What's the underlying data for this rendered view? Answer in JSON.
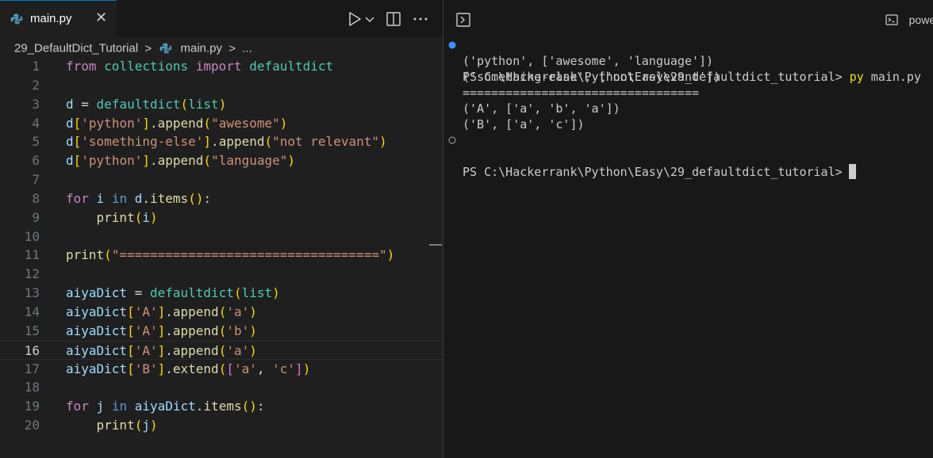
{
  "editor": {
    "tab": {
      "label": "main.py",
      "close": "✕"
    },
    "toolbar": {
      "more": "···"
    },
    "breadcrumb": {
      "folder": "29_DefaultDict_Tutorial",
      "file": "main.py",
      "ellipsis": "..."
    },
    "current_line": 16,
    "lines": [
      {
        "n": "1",
        "tokens": [
          {
            "t": "from",
            "c": "kw"
          },
          {
            "t": " "
          },
          {
            "t": "collections",
            "c": "cl"
          },
          {
            "t": " "
          },
          {
            "t": "import",
            "c": "kw"
          },
          {
            "t": " "
          },
          {
            "t": "defaultdict",
            "c": "cl"
          }
        ]
      },
      {
        "n": "2",
        "tokens": []
      },
      {
        "n": "3",
        "tokens": [
          {
            "t": "d",
            "c": "vr"
          },
          {
            "t": " = ",
            "c": "pl"
          },
          {
            "t": "defaultdict",
            "c": "cl"
          },
          {
            "t": "(",
            "c": "b1"
          },
          {
            "t": "list",
            "c": "cl"
          },
          {
            "t": ")",
            "c": "b1"
          }
        ]
      },
      {
        "n": "4",
        "tokens": [
          {
            "t": "d",
            "c": "vr"
          },
          {
            "t": "[",
            "c": "b1"
          },
          {
            "t": "'python'",
            "c": "st"
          },
          {
            "t": "]",
            "c": "b1"
          },
          {
            "t": ".",
            "c": "pl"
          },
          {
            "t": "append",
            "c": "fn"
          },
          {
            "t": "(",
            "c": "b1"
          },
          {
            "t": "\"awesome\"",
            "c": "st"
          },
          {
            "t": ")",
            "c": "b1"
          }
        ]
      },
      {
        "n": "5",
        "tokens": [
          {
            "t": "d",
            "c": "vr"
          },
          {
            "t": "[",
            "c": "b1"
          },
          {
            "t": "'something-else'",
            "c": "st"
          },
          {
            "t": "]",
            "c": "b1"
          },
          {
            "t": ".",
            "c": "pl"
          },
          {
            "t": "append",
            "c": "fn"
          },
          {
            "t": "(",
            "c": "b1"
          },
          {
            "t": "\"not relevant\"",
            "c": "st"
          },
          {
            "t": ")",
            "c": "b1"
          }
        ]
      },
      {
        "n": "6",
        "tokens": [
          {
            "t": "d",
            "c": "vr"
          },
          {
            "t": "[",
            "c": "b1"
          },
          {
            "t": "'python'",
            "c": "st"
          },
          {
            "t": "]",
            "c": "b1"
          },
          {
            "t": ".",
            "c": "pl"
          },
          {
            "t": "append",
            "c": "fn"
          },
          {
            "t": "(",
            "c": "b1"
          },
          {
            "t": "\"language\"",
            "c": "st"
          },
          {
            "t": ")",
            "c": "b1"
          }
        ]
      },
      {
        "n": "7",
        "tokens": []
      },
      {
        "n": "8",
        "tokens": [
          {
            "t": "for",
            "c": "kw"
          },
          {
            "t": " "
          },
          {
            "t": "i",
            "c": "vr"
          },
          {
            "t": " "
          },
          {
            "t": "in",
            "c": "kw2"
          },
          {
            "t": " "
          },
          {
            "t": "d",
            "c": "vr"
          },
          {
            "t": ".",
            "c": "pl"
          },
          {
            "t": "items",
            "c": "fn"
          },
          {
            "t": "(",
            "c": "b1"
          },
          {
            "t": ")",
            "c": "b1"
          },
          {
            "t": ":",
            "c": "pl"
          }
        ]
      },
      {
        "n": "9",
        "tokens": [
          {
            "t": "    "
          },
          {
            "t": "print",
            "c": "fn"
          },
          {
            "t": "(",
            "c": "b1"
          },
          {
            "t": "i",
            "c": "vr"
          },
          {
            "t": ")",
            "c": "b1"
          }
        ]
      },
      {
        "n": "10",
        "tokens": []
      },
      {
        "n": "11",
        "tokens": [
          {
            "t": "print",
            "c": "fn"
          },
          {
            "t": "(",
            "c": "b1"
          },
          {
            "t": "\"==================================\"",
            "c": "st"
          },
          {
            "t": ")",
            "c": "b1"
          }
        ]
      },
      {
        "n": "12",
        "tokens": []
      },
      {
        "n": "13",
        "tokens": [
          {
            "t": "aiyaDict",
            "c": "vr"
          },
          {
            "t": " = ",
            "c": "pl"
          },
          {
            "t": "defaultdict",
            "c": "cl"
          },
          {
            "t": "(",
            "c": "b1"
          },
          {
            "t": "list",
            "c": "cl"
          },
          {
            "t": ")",
            "c": "b1"
          }
        ]
      },
      {
        "n": "14",
        "tokens": [
          {
            "t": "aiyaDict",
            "c": "vr"
          },
          {
            "t": "[",
            "c": "b1"
          },
          {
            "t": "'A'",
            "c": "st"
          },
          {
            "t": "]",
            "c": "b1"
          },
          {
            "t": ".",
            "c": "pl"
          },
          {
            "t": "append",
            "c": "fn"
          },
          {
            "t": "(",
            "c": "b1"
          },
          {
            "t": "'a'",
            "c": "st"
          },
          {
            "t": ")",
            "c": "b1"
          }
        ]
      },
      {
        "n": "15",
        "tokens": [
          {
            "t": "aiyaDict",
            "c": "vr"
          },
          {
            "t": "[",
            "c": "b1"
          },
          {
            "t": "'A'",
            "c": "st"
          },
          {
            "t": "]",
            "c": "b1"
          },
          {
            "t": ".",
            "c": "pl"
          },
          {
            "t": "append",
            "c": "fn"
          },
          {
            "t": "(",
            "c": "b1"
          },
          {
            "t": "'b'",
            "c": "st"
          },
          {
            "t": ")",
            "c": "b1"
          }
        ]
      },
      {
        "n": "16",
        "tokens": [
          {
            "t": "aiyaDict",
            "c": "vr"
          },
          {
            "t": "[",
            "c": "b1"
          },
          {
            "t": "'A'",
            "c": "st"
          },
          {
            "t": "]",
            "c": "b1"
          },
          {
            "t": ".",
            "c": "pl"
          },
          {
            "t": "append",
            "c": "fn"
          },
          {
            "t": "(",
            "c": "b1"
          },
          {
            "t": "'a'",
            "c": "st"
          },
          {
            "t": ")",
            "c": "b1"
          }
        ]
      },
      {
        "n": "17",
        "tokens": [
          {
            "t": "aiyaDict",
            "c": "vr"
          },
          {
            "t": "[",
            "c": "b1"
          },
          {
            "t": "'B'",
            "c": "st"
          },
          {
            "t": "]",
            "c": "b1"
          },
          {
            "t": ".",
            "c": "pl"
          },
          {
            "t": "extend",
            "c": "fn"
          },
          {
            "t": "(",
            "c": "b1"
          },
          {
            "t": "[",
            "c": "b2"
          },
          {
            "t": "'a'",
            "c": "st"
          },
          {
            "t": ", ",
            "c": "pl"
          },
          {
            "t": "'c'",
            "c": "st"
          },
          {
            "t": "]",
            "c": "b2"
          },
          {
            "t": ")",
            "c": "b1"
          }
        ]
      },
      {
        "n": "18",
        "tokens": []
      },
      {
        "n": "19",
        "tokens": [
          {
            "t": "for",
            "c": "kw"
          },
          {
            "t": " "
          },
          {
            "t": "j",
            "c": "vr"
          },
          {
            "t": " "
          },
          {
            "t": "in",
            "c": "kw2"
          },
          {
            "t": " "
          },
          {
            "t": "aiyaDict",
            "c": "vr"
          },
          {
            "t": ".",
            "c": "pl"
          },
          {
            "t": "items",
            "c": "fn"
          },
          {
            "t": "(",
            "c": "b1"
          },
          {
            "t": ")",
            "c": "b1"
          },
          {
            "t": ":",
            "c": "pl"
          }
        ]
      },
      {
        "n": "20",
        "tokens": [
          {
            "t": "    "
          },
          {
            "t": "print",
            "c": "fn"
          },
          {
            "t": "(",
            "c": "b1"
          },
          {
            "t": "j",
            "c": "vr"
          },
          {
            "t": ")",
            "c": "b1"
          }
        ]
      }
    ]
  },
  "terminal": {
    "tab_label": "powe",
    "prompt": "PS C:\\Hackerrank\\Python\\Easy\\29_defaultdict_tutorial>",
    "command_name": "py",
    "command_arg": "main.py",
    "output": [
      "('python', ['awesome', 'language'])",
      "('something-else', ['not relevant'])",
      "=================================",
      "('A', ['a', 'b', 'a'])",
      "('B', ['a', 'c'])"
    ]
  },
  "colors": {
    "accent": "#0078d4",
    "success_dot": "#3794ff",
    "string": "#ce9178",
    "keyword": "#c586c0",
    "function": "#dcdcaa",
    "variable": "#9cdcfe",
    "class": "#4ec9b0"
  }
}
